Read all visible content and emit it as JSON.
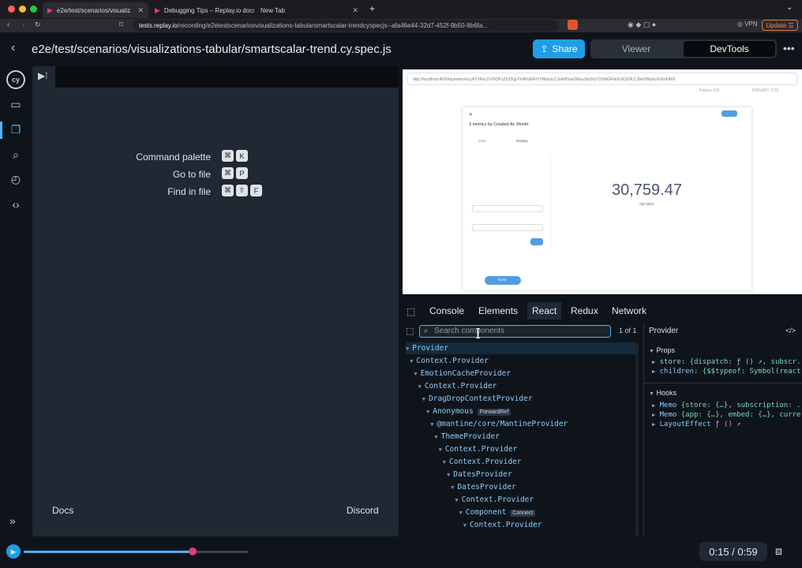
{
  "browser": {
    "tabs": [
      {
        "label": "e2e/test/scenarios/visualiz",
        "active": true
      },
      {
        "label": "Debugging Tips – Replay.io docs",
        "active": false
      },
      {
        "label": "New Tab",
        "active": false
      }
    ],
    "url_host": "tests.replay.io",
    "url_path": "/recording/e2etestscenariosvisualizations-tabularsmartscalar-trendcyspecjs--afa46e44-32d7-452f-9b50-8b6fa...",
    "vpn_label": "VPN",
    "update_label": "Update"
  },
  "header": {
    "title": "e2e/test/scenarios/visualizations-tabular/smartscalar-trend.cy.spec.js",
    "share_label": "Share",
    "viewer_label": "Viewer",
    "devtools_label": "DevTools"
  },
  "left_panel": {
    "commands": [
      {
        "label": "Command palette",
        "keys": [
          "⌘",
          "K"
        ]
      },
      {
        "label": "Go to file",
        "keys": [
          "⌘",
          "P"
        ]
      },
      {
        "label": "Find in file",
        "keys": [
          "⌘",
          "⇧",
          "F"
        ]
      }
    ],
    "docs_label": "Docs",
    "discord_label": "Discord"
  },
  "preview": {
    "url": "http://localhost:4000/question#eyJkYXRhc2V0X3F1ZXJ5Ijp7ImRhdGFiYXNlIjoxLCJxdWVyeSI6eyJzb3VyY2UtdGFibGUiOjV9LCJ0eXBlIjoicXVlcnkifX0",
    "meta_left": "Replay 100",
    "meta_right": "1280x800 3739",
    "question_title": "3 metrics by Created At: Month",
    "tab_editor": "Data",
    "tab_display": "Display",
    "big_number": "30,759.47",
    "big_sub": "Apr 2022",
    "done_label": "Done"
  },
  "devtools": {
    "tabs": [
      "Console",
      "Elements",
      "React",
      "Redux",
      "Network"
    ],
    "active_tab": "React",
    "search_placeholder": "Search components",
    "match_count": "1 of 1",
    "tree": [
      {
        "name": "Provider",
        "depth": 0,
        "selected": true
      },
      {
        "name": "Context.Provider",
        "depth": 1
      },
      {
        "name": "EmotionCacheProvider",
        "depth": 2
      },
      {
        "name": "Context.Provider",
        "depth": 3
      },
      {
        "name": "DragDropContextProvider",
        "depth": 4
      },
      {
        "name": "Anonymous",
        "depth": 5,
        "badge": "ForwardRef"
      },
      {
        "name": "@mantine/core/MantineProvider",
        "depth": 6
      },
      {
        "name": "ThemeProvider",
        "depth": 7
      },
      {
        "name": "Context.Provider",
        "depth": 8
      },
      {
        "name": "Context.Provider",
        "depth": 9
      },
      {
        "name": "DatesProvider",
        "depth": 10
      },
      {
        "name": "DatesProvider",
        "depth": 11
      },
      {
        "name": "Context.Provider",
        "depth": 12
      },
      {
        "name": "Component",
        "depth": 13,
        "badge": "Connect"
      },
      {
        "name": "Context.Provider",
        "depth": 14
      }
    ],
    "props_header": "Provider",
    "props_section": "Props",
    "props": [
      {
        "key": "store:",
        "val": "{dispatch: ƒ () ↗, subscr..."
      },
      {
        "key": "children:",
        "val": "{$$typeof: Symbol(react..."
      }
    ],
    "hooks_section": "Hooks",
    "hooks": [
      {
        "key": "Memo",
        "val": "{store: {…}, subscription: ..."
      },
      {
        "key": "Memo",
        "val": "{app: {…}, embed: {…}, curre..."
      },
      {
        "key": "LayoutEffect",
        "val": "ƒ () ↗"
      }
    ]
  },
  "player": {
    "time": "0:15 / 0:59",
    "progress": 0.75
  }
}
